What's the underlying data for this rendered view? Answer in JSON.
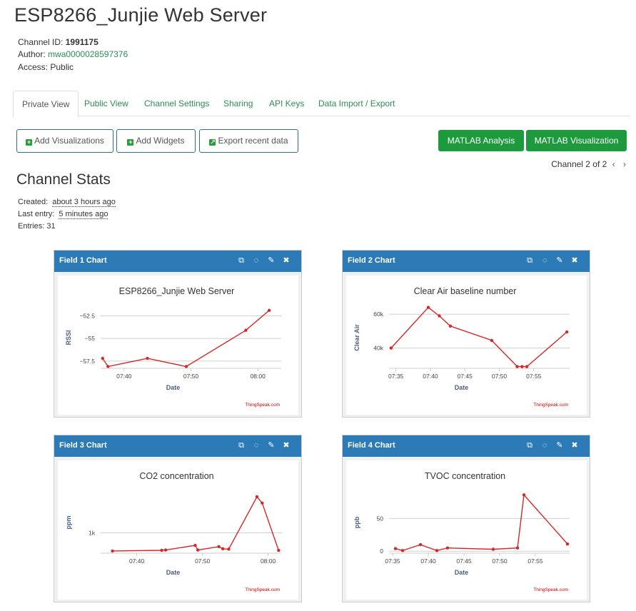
{
  "header": {
    "title": "ESP8266_Junjie Web Server",
    "channel_id_label": "Channel ID:",
    "channel_id": "1991175",
    "author_label": "Author:",
    "author": "mwa0000028597376",
    "access_label": "Access:",
    "access": "Public"
  },
  "tabs": [
    "Private View",
    "Public View",
    "Channel Settings",
    "Sharing",
    "API Keys",
    "Data Import / Export"
  ],
  "buttons": {
    "add_visualizations": "Add Visualizations",
    "add_widgets": "Add Widgets",
    "export_recent": "Export recent data",
    "matlab_analysis": "MATLAB Analysis",
    "matlab_visualization": "MATLAB Visualization"
  },
  "pager": {
    "text": "Channel 2 of 2"
  },
  "stats": {
    "title": "Channel Stats",
    "created_label": "Created:",
    "created": "about 3 hours ago",
    "last_entry_label": "Last entry:",
    "last_entry": "5 minutes ago",
    "entries_label": "Entries:",
    "entries": "31"
  },
  "colors": {
    "widget_header": "#2c7bb6",
    "line": "#d62728",
    "green": "#1e9a3e",
    "link": "#2e8b57"
  },
  "chart_data": [
    {
      "type": "line",
      "widget_title": "Field 1 Chart",
      "title": "ESP8266_Junjie Web Server",
      "ylabel": "RSSI",
      "xlabel": "Date",
      "xlim": [
        36.5,
        63.5
      ],
      "ylim": [
        -58.3,
        -51.2
      ],
      "x": [
        36.8,
        37.6,
        43.5,
        49.3,
        58.2,
        61.7
      ],
      "y": [
        -57.2,
        -58.1,
        -57.2,
        -58.1,
        -54.1,
        -51.9
      ],
      "xticks": [
        {
          "v": 40,
          "label": "07:40"
        },
        {
          "v": 50,
          "label": "07:50"
        },
        {
          "v": 60,
          "label": "08:00"
        }
      ],
      "yticks": [
        {
          "v": -52.5,
          "label": "−52.5"
        },
        {
          "v": -55,
          "label": "−55"
        },
        {
          "v": -57.5,
          "label": "−57.5"
        }
      ],
      "credit": "ThingSpeak.com"
    },
    {
      "type": "line",
      "widget_title": "Field 2 Chart",
      "title": "Clear Air baseline number",
      "ylabel": "Clear Air",
      "xlabel": "Date",
      "xlim": [
        34.0,
        60.2
      ],
      "ylim": [
        28000,
        66000
      ],
      "x": [
        34.3,
        39.7,
        41.3,
        42.9,
        48.9,
        52.6,
        53.3,
        54.0,
        59.8
      ],
      "y": [
        40000,
        64000,
        59000,
        53000,
        44500,
        29000,
        29000,
        29000,
        49500
      ],
      "xticks": [
        {
          "v": 35,
          "label": "07:35"
        },
        {
          "v": 40,
          "label": "07:40"
        },
        {
          "v": 45,
          "label": "07:45"
        },
        {
          "v": 50,
          "label": "07:50"
        },
        {
          "v": 55,
          "label": "07:55"
        }
      ],
      "yticks": [
        {
          "v": 40000,
          "label": "40k"
        },
        {
          "v": 60000,
          "label": "60k"
        }
      ],
      "credit": "ThingSpeak.com"
    },
    {
      "type": "line",
      "widget_title": "Field 3 Chart",
      "title": "CO2 concentration",
      "ylabel": "ppm",
      "xlabel": "Date",
      "xlim": [
        34.5,
        62.0
      ],
      "ylim": [
        350,
        2400
      ],
      "x": [
        36.3,
        43.8,
        44.4,
        48.9,
        49.3,
        52.5,
        53.1,
        54.0,
        58.3,
        59.1,
        61.6
      ],
      "y": [
        420,
        440,
        450,
        600,
        450,
        560,
        490,
        480,
        2150,
        1950,
        440
      ],
      "xticks": [
        {
          "v": 40,
          "label": "07:40"
        },
        {
          "v": 50,
          "label": "07:50"
        },
        {
          "v": 60,
          "label": "08:00"
        }
      ],
      "yticks": [
        {
          "v": 1000,
          "label": "1k"
        }
      ],
      "credit": "ThingSpeak.com"
    },
    {
      "type": "line",
      "widget_title": "Field 4 Chart",
      "title": "TVOC concentration",
      "ylabel": "ppb",
      "xlabel": "Date",
      "xlim": [
        34.5,
        59.8
      ],
      "ylim": [
        -3,
        95
      ],
      "x": [
        35.4,
        36.4,
        38.9,
        41.2,
        42.7,
        49.1,
        52.5,
        53.4,
        59.5
      ],
      "y": [
        4,
        1,
        10,
        1,
        5,
        3,
        5,
        86,
        11
      ],
      "xticks": [
        {
          "v": 35,
          "label": "07:35"
        },
        {
          "v": 40,
          "label": "07:40"
        },
        {
          "v": 45,
          "label": "07:45"
        },
        {
          "v": 50,
          "label": "07:50"
        },
        {
          "v": 55,
          "label": "07:55"
        }
      ],
      "yticks": [
        {
          "v": 0,
          "label": "0"
        },
        {
          "v": 50,
          "label": "50"
        }
      ],
      "credit": "ThingSpeak.com"
    }
  ]
}
